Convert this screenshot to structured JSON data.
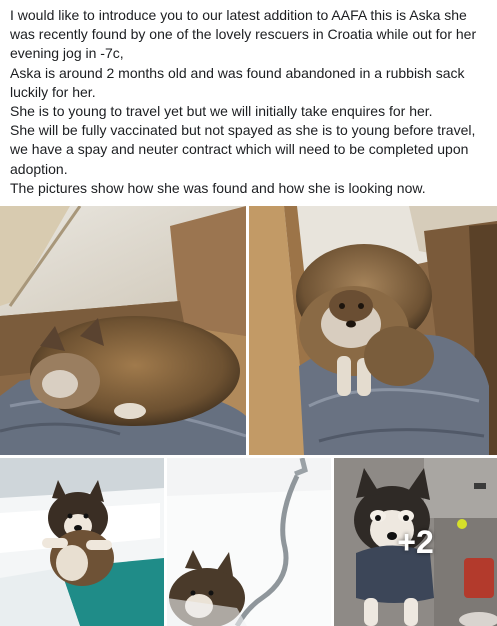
{
  "post": {
    "paragraphs": [
      "I would like to introduce you to our latest addition to AAFA this is Aska she was recently found by one of the lovely rescuers in Croatia while out for her evening jog in -7c,",
      "Aska is around 2 months old and was found abandoned in a rubbish sack luckily for her.",
      "She is to young to travel yet but we will initially take enquires for her.",
      "She will be fully vaccinated but not spayed as she is to young before travel, we have a spay and neuter contract which will need to be completed upon adoption.",
      "The pictures show how she was found and how she is looking now."
    ]
  },
  "photos": {
    "more_count_label": "+2",
    "items": [
      {
        "name": "puppy-found-curled-photo"
      },
      {
        "name": "puppy-found-sitting-photo"
      },
      {
        "name": "puppy-bathtub-photo"
      },
      {
        "name": "puppy-shower-photo"
      },
      {
        "name": "puppy-sweater-photo"
      }
    ]
  },
  "colors": {
    "text": "#1c1e21",
    "wood": "#b08a5e",
    "wood_dark": "#6e5236",
    "blanket": "#6d7480",
    "fur": "#8a6a44",
    "bath_teal": "#1f8c88",
    "overlay_text": "#ffffff"
  }
}
